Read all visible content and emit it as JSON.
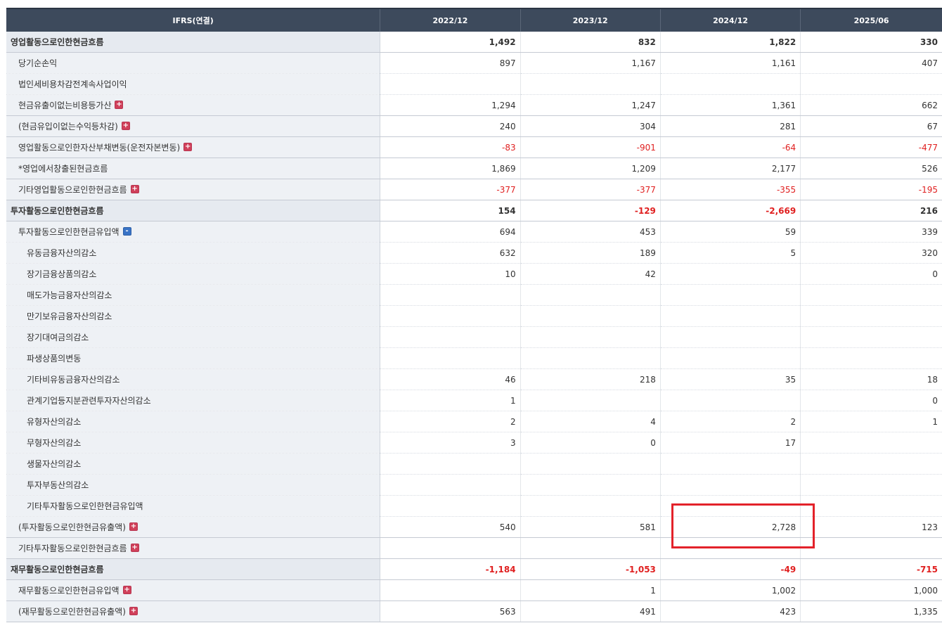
{
  "header": {
    "title": "IFRS(연결)",
    "periods": [
      "2022/12",
      "2023/12",
      "2024/12",
      "2025/06"
    ]
  },
  "rows": [
    {
      "label": "영업활동으로인한현금흐름",
      "level": 0,
      "section": true,
      "toggle": "",
      "values": [
        "1,492",
        "832",
        "1,822",
        "330"
      ]
    },
    {
      "label": "당기순손익",
      "level": 1,
      "toggle": "",
      "values": [
        "897",
        "1,167",
        "1,161",
        "407"
      ]
    },
    {
      "label": "법인세비용차감전계속사업이익",
      "level": 1,
      "toggle": "",
      "values": [
        "",
        "",
        "",
        ""
      ]
    },
    {
      "label": "현금유출이없는비용등가산",
      "level": 1,
      "toggle": "+",
      "values": [
        "1,294",
        "1,247",
        "1,361",
        "662"
      ]
    },
    {
      "label": "(현금유입이없는수익등차감)",
      "level": 1,
      "toggle": "+",
      "values": [
        "240",
        "304",
        "281",
        "67"
      ]
    },
    {
      "label": "영업활동으로인한자산부채변동(운전자본변동)",
      "level": 1,
      "toggle": "+",
      "values": [
        "-83",
        "-901",
        "-64",
        "-477"
      ]
    },
    {
      "label": "*영업에서창출된현금흐름",
      "level": 1,
      "toggle": "",
      "values": [
        "1,869",
        "1,209",
        "2,177",
        "526"
      ]
    },
    {
      "label": "기타영업활동으로인한현금흐름",
      "level": 1,
      "toggle": "+",
      "values": [
        "-377",
        "-377",
        "-355",
        "-195"
      ]
    },
    {
      "label": "투자활동으로인한현금흐름",
      "level": 0,
      "section": true,
      "toggle": "",
      "values": [
        "154",
        "-129",
        "-2,669",
        "216"
      ]
    },
    {
      "label": "투자활동으로인한현금유입액",
      "level": 1,
      "toggle": "-",
      "values": [
        "694",
        "453",
        "59",
        "339"
      ]
    },
    {
      "label": "유동금융자산의감소",
      "level": 2,
      "toggle": "",
      "values": [
        "632",
        "189",
        "5",
        "320"
      ]
    },
    {
      "label": "장기금융상품의감소",
      "level": 2,
      "toggle": "",
      "values": [
        "10",
        "42",
        "",
        "0"
      ]
    },
    {
      "label": "매도가능금융자산의감소",
      "level": 2,
      "toggle": "",
      "values": [
        "",
        "",
        "",
        ""
      ]
    },
    {
      "label": "만기보유금융자산의감소",
      "level": 2,
      "toggle": "",
      "values": [
        "",
        "",
        "",
        ""
      ]
    },
    {
      "label": "장기대여금의감소",
      "level": 2,
      "toggle": "",
      "values": [
        "",
        "",
        "",
        ""
      ]
    },
    {
      "label": "파생상품의변동",
      "level": 2,
      "toggle": "",
      "values": [
        "",
        "",
        "",
        ""
      ]
    },
    {
      "label": "기타비유동금융자산의감소",
      "level": 2,
      "toggle": "",
      "values": [
        "46",
        "218",
        "35",
        "18"
      ]
    },
    {
      "label": "관계기업등지분관련투자자산의감소",
      "level": 2,
      "toggle": "",
      "values": [
        "1",
        "",
        "",
        "0"
      ]
    },
    {
      "label": "유형자산의감소",
      "level": 2,
      "toggle": "",
      "values": [
        "2",
        "4",
        "2",
        "1"
      ]
    },
    {
      "label": "무형자산의감소",
      "level": 2,
      "toggle": "",
      "values": [
        "3",
        "0",
        "17",
        ""
      ]
    },
    {
      "label": "생물자산의감소",
      "level": 2,
      "toggle": "",
      "values": [
        "",
        "",
        "",
        ""
      ]
    },
    {
      "label": "투자부동산의감소",
      "level": 2,
      "toggle": "",
      "values": [
        "",
        "",
        "",
        ""
      ]
    },
    {
      "label": "기타투자활동으로인한현금유입액",
      "level": 2,
      "toggle": "",
      "values": [
        "",
        "",
        "",
        ""
      ]
    },
    {
      "label": "(투자활동으로인한현금유출액)",
      "level": 1,
      "toggle": "+",
      "values": [
        "540",
        "581",
        "2,728",
        "123"
      ]
    },
    {
      "label": "기타투자활동으로인한현금흐름",
      "level": 1,
      "toggle": "+",
      "values": [
        "",
        "",
        "",
        ""
      ]
    },
    {
      "label": "재무활동으로인한현금흐름",
      "level": 0,
      "section": true,
      "toggle": "",
      "values": [
        "-1,184",
        "-1,053",
        "-49",
        "-715"
      ]
    },
    {
      "label": "재무활동으로인한현금유입액",
      "level": 1,
      "toggle": "+",
      "values": [
        "",
        "1",
        "1,002",
        "1,000"
      ]
    },
    {
      "label": "(재무활동으로인한현금유출액)",
      "level": 1,
      "toggle": "+",
      "values": [
        "563",
        "491",
        "423",
        "1,335"
      ]
    }
  ],
  "colors": {
    "header_bg": "#3d4a5c",
    "negative": "#e02020",
    "highlight": "#e3222a",
    "toggle_plus": "#d0405a",
    "toggle_minus": "#3a74c6"
  },
  "toggle_symbols": {
    "plus": "+",
    "minus": "-"
  }
}
